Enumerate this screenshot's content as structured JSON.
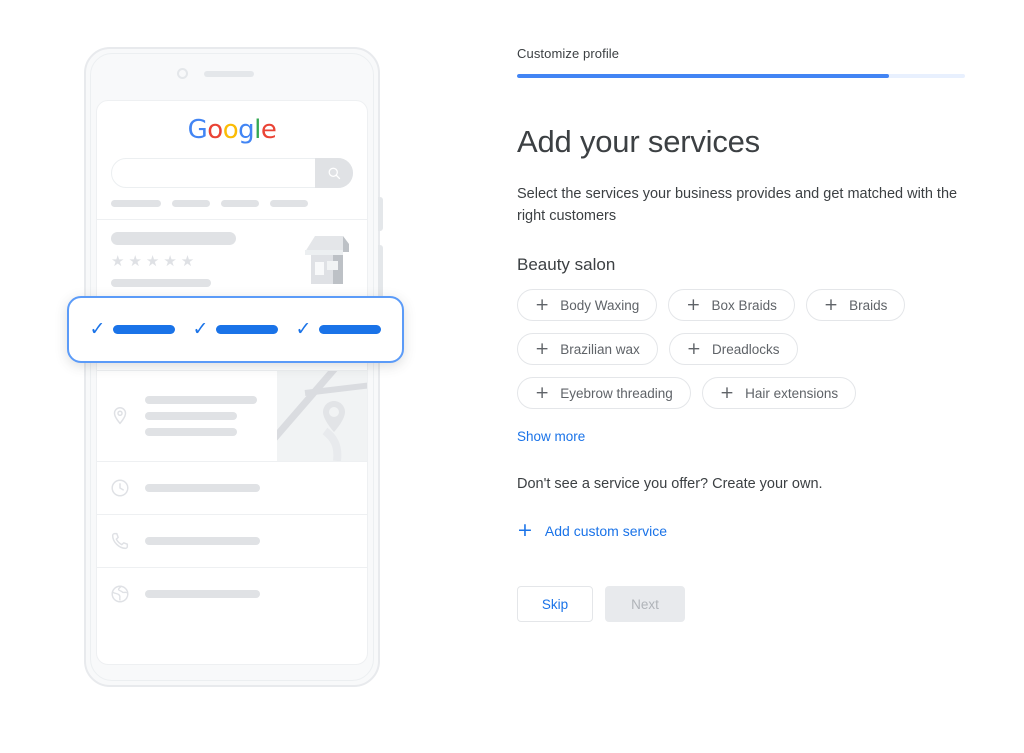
{
  "phone_preview": {
    "logo": {
      "letters": [
        {
          "ch": "G",
          "color": "#4285F4"
        },
        {
          "ch": "o",
          "color": "#EA4335"
        },
        {
          "ch": "o",
          "color": "#FBBC05"
        },
        {
          "ch": "g",
          "color": "#4285F4"
        },
        {
          "ch": "l",
          "color": "#34A853"
        },
        {
          "ch": "e",
          "color": "#EA4335"
        }
      ],
      "name": "google-logo"
    },
    "search_icon": "search-icon",
    "stars": "★★★★★",
    "chevron": "›",
    "highlight_card": {
      "items": [
        {
          "check": "✓"
        },
        {
          "check": "✓"
        },
        {
          "check": "✓"
        }
      ]
    },
    "info_rows": [
      {
        "icon": "location-pin-icon"
      },
      {
        "icon": "clock-icon"
      },
      {
        "icon": "phone-icon"
      },
      {
        "icon": "globe-icon"
      }
    ]
  },
  "form": {
    "step_label": "Customize profile",
    "progress_percent": 83,
    "title": "Add your services",
    "description": "Select the services your business provides and get matched with the right customers",
    "category": "Beauty salon",
    "chip_rows": [
      [
        {
          "label": "Body Waxing"
        },
        {
          "label": "Box Braids"
        },
        {
          "label": "Braids"
        }
      ],
      [
        {
          "label": "Brazilian wax"
        },
        {
          "label": "Dreadlocks"
        }
      ],
      [
        {
          "label": "Eyebrow threading"
        },
        {
          "label": "Hair extensions"
        }
      ]
    ],
    "show_more": "Show more",
    "create_own_text": "Don't see a service you offer? Create your own.",
    "add_custom": {
      "plus": "+",
      "label": "Add custom service"
    },
    "buttons": {
      "skip": "Skip",
      "next": "Next"
    },
    "colors": {
      "accent": "#1a73e8",
      "progress_fill": "#4285f4",
      "progress_track": "#e8f0fe"
    }
  }
}
